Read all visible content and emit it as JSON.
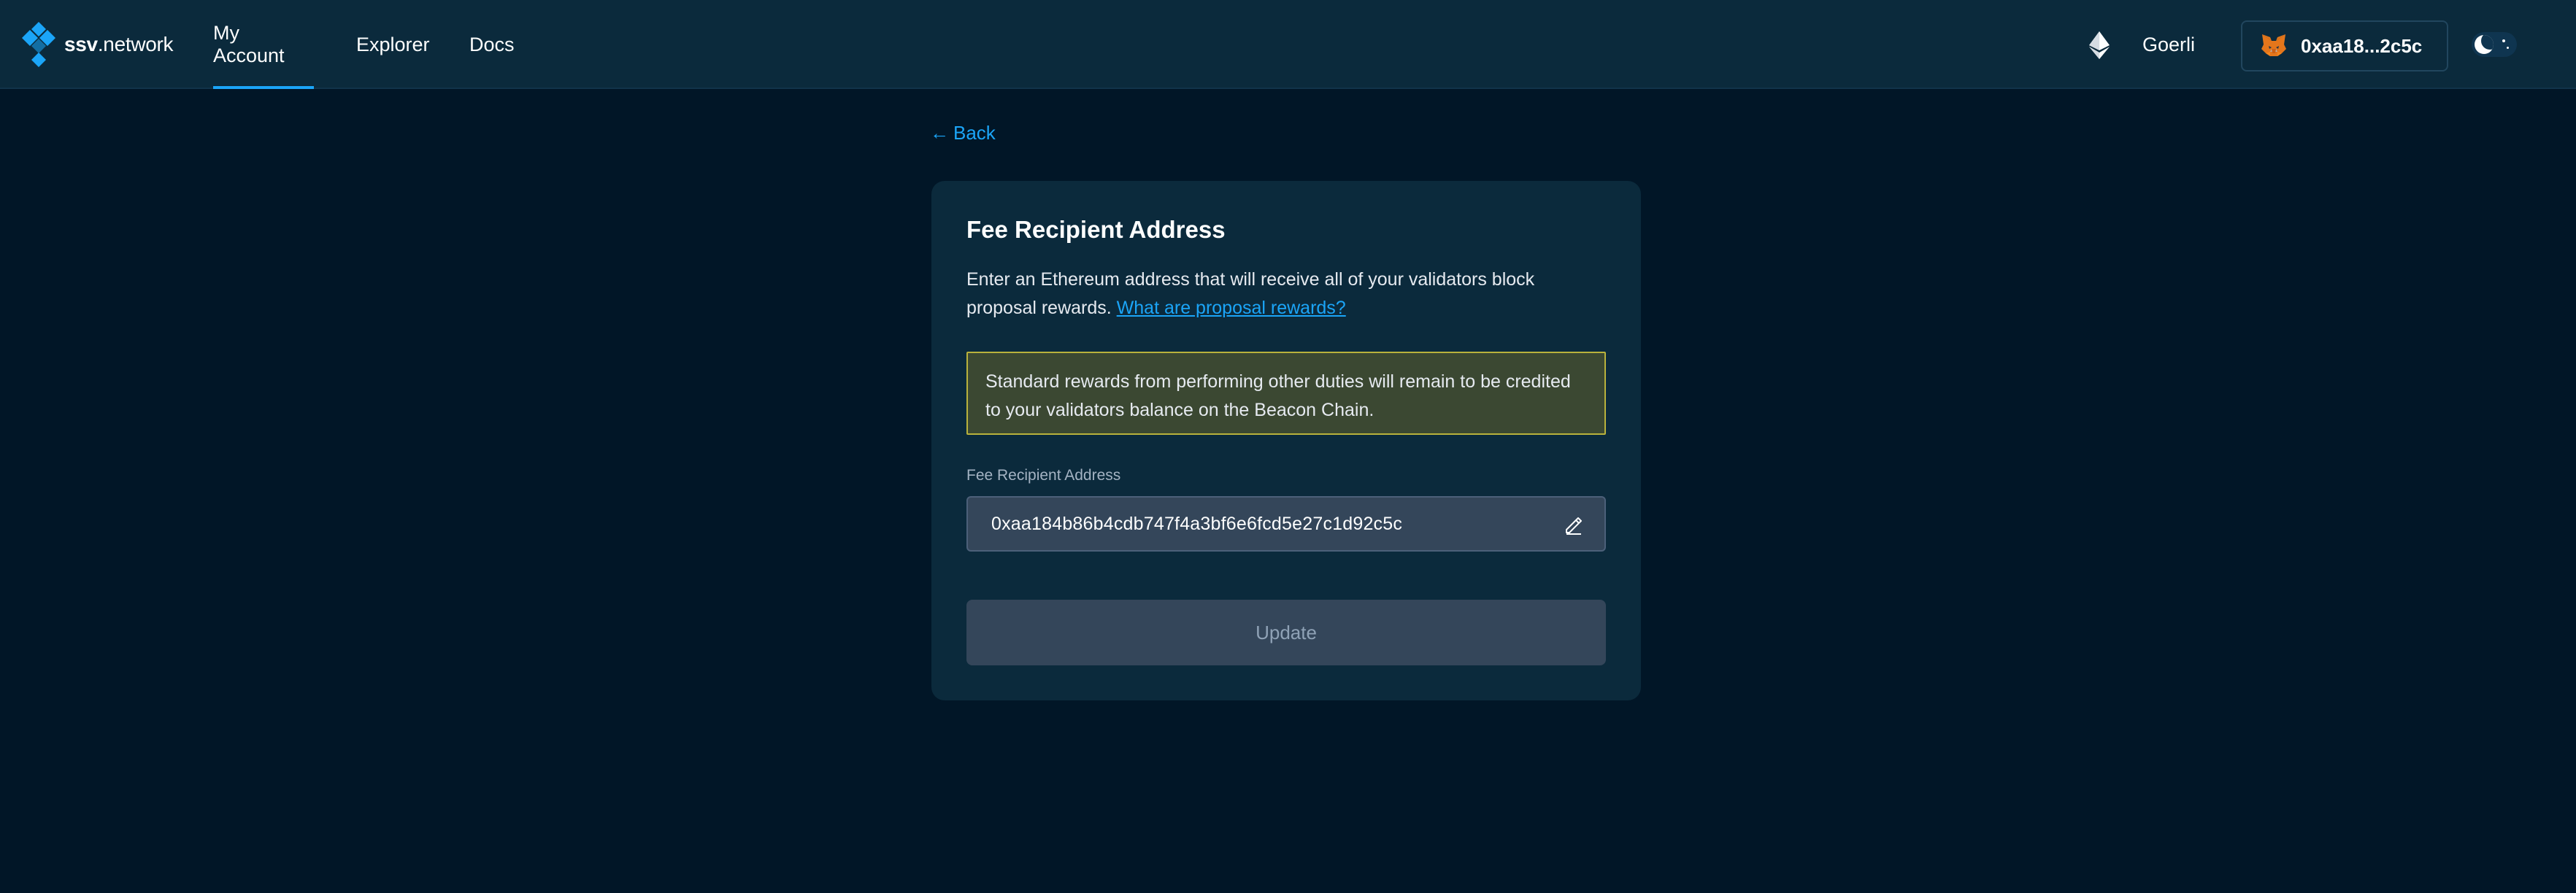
{
  "header": {
    "logo": {
      "brand_bold": "ssv",
      "brand_rest": ".network",
      "icon": "ssv-diamond-logo"
    },
    "nav": [
      {
        "label": "My Account",
        "active": true
      },
      {
        "label": "Explorer",
        "active": false
      },
      {
        "label": "Docs",
        "active": false
      }
    ],
    "network": {
      "icon": "ethereum-icon",
      "label": "Goerli"
    },
    "wallet": {
      "icon": "metamask-fox-icon",
      "address": "0xaa18...2c5c"
    },
    "theme_toggle": {
      "mode": "dark",
      "icon": "moon-icon"
    }
  },
  "back_link": {
    "icon": "arrow-left-icon",
    "label": "Back"
  },
  "card": {
    "title": "Fee Recipient Address",
    "description": "Enter an Ethereum address that will receive all of your validators block proposal rewards.",
    "description_link": "What are proposal rewards?",
    "warning": "Standard rewards from performing other duties will remain to be credited to your validators balance on the Beacon Chain.",
    "field_label": "Fee Recipient Address",
    "field_value": "0xaa184b86b4cdb747f4a3bf6e6fcd5e27c1d92c5c",
    "edit_icon": "pencil-icon",
    "update_label": "Update",
    "update_disabled": true
  },
  "colors": {
    "background": "#011627",
    "surface": "#0B2A3C",
    "accent": "#1BA5F8",
    "warning_bg": "#3B4832",
    "warning_border": "#B9B23C",
    "input_bg": "#34465A",
    "disabled_text": "#8FA2B6"
  }
}
